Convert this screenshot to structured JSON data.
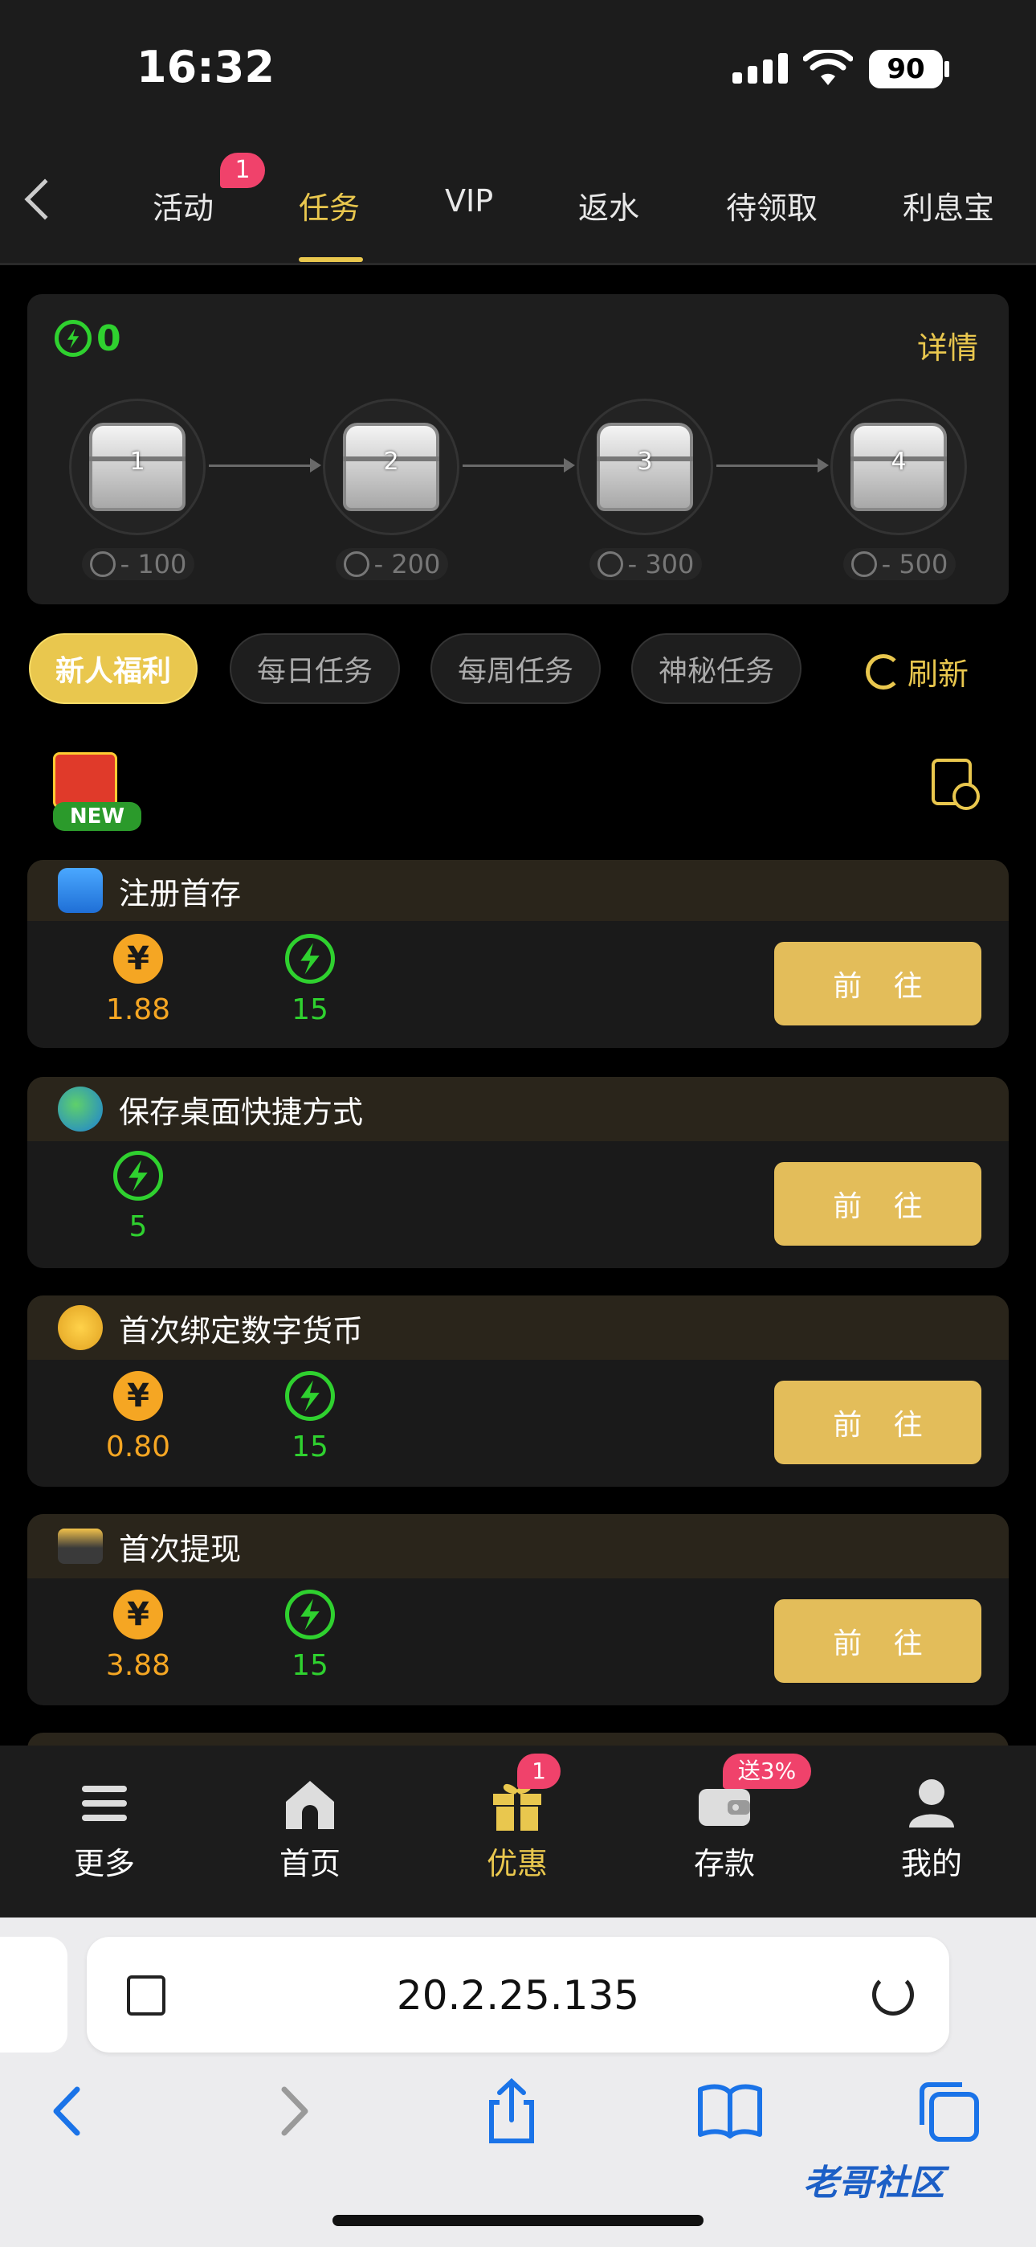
{
  "status_bar": {
    "time": "16:32",
    "battery": "90"
  },
  "top_nav": {
    "tabs": [
      {
        "label": "活动",
        "badge": "1"
      },
      {
        "label": "任务",
        "active": true
      },
      {
        "label": "VIP"
      },
      {
        "label": "返水"
      },
      {
        "label": "待领取"
      },
      {
        "label": "利息宝"
      }
    ]
  },
  "energy": {
    "score": "0",
    "details_label": "详情",
    "chests": [
      {
        "num": "1",
        "cost": "- 100"
      },
      {
        "num": "2",
        "cost": "- 200"
      },
      {
        "num": "3",
        "cost": "- 300"
      },
      {
        "num": "4",
        "cost": "- 500"
      }
    ]
  },
  "filters": {
    "pills": [
      "新人福利",
      "每日任务",
      "每周任务",
      "神秘任务"
    ],
    "refresh_label": "刷新"
  },
  "new_badge": "NEW",
  "tasks": [
    {
      "title": "注册首存",
      "cash": "1.88",
      "energy": "15",
      "button": "前 往"
    },
    {
      "title": "保存桌面快捷方式",
      "energy": "5",
      "button": "前 往"
    },
    {
      "title": "首次绑定数字货币",
      "cash": "0.80",
      "energy": "15",
      "button": "前 往"
    },
    {
      "title": "首次提现",
      "cash": "3.88",
      "energy": "15",
      "button": "前 往"
    }
  ],
  "bottom_tabs": [
    {
      "label": "更多",
      "icon": "menu-icon"
    },
    {
      "label": "首页",
      "icon": "home-icon"
    },
    {
      "label": "优惠",
      "icon": "gift-icon",
      "badge": "1",
      "active": true
    },
    {
      "label": "存款",
      "icon": "wallet-icon",
      "badge": "送3%"
    },
    {
      "label": "我的",
      "icon": "user-icon"
    }
  ],
  "safari": {
    "url": "20.2.25.135"
  },
  "watermark": "老哥社区",
  "colors": {
    "accent": "#e9c74e",
    "energy_green": "#2fd12f",
    "coin_orange": "#f5a623",
    "badge_pink": "#f0426b",
    "button_gold": "#e3bd5a"
  }
}
